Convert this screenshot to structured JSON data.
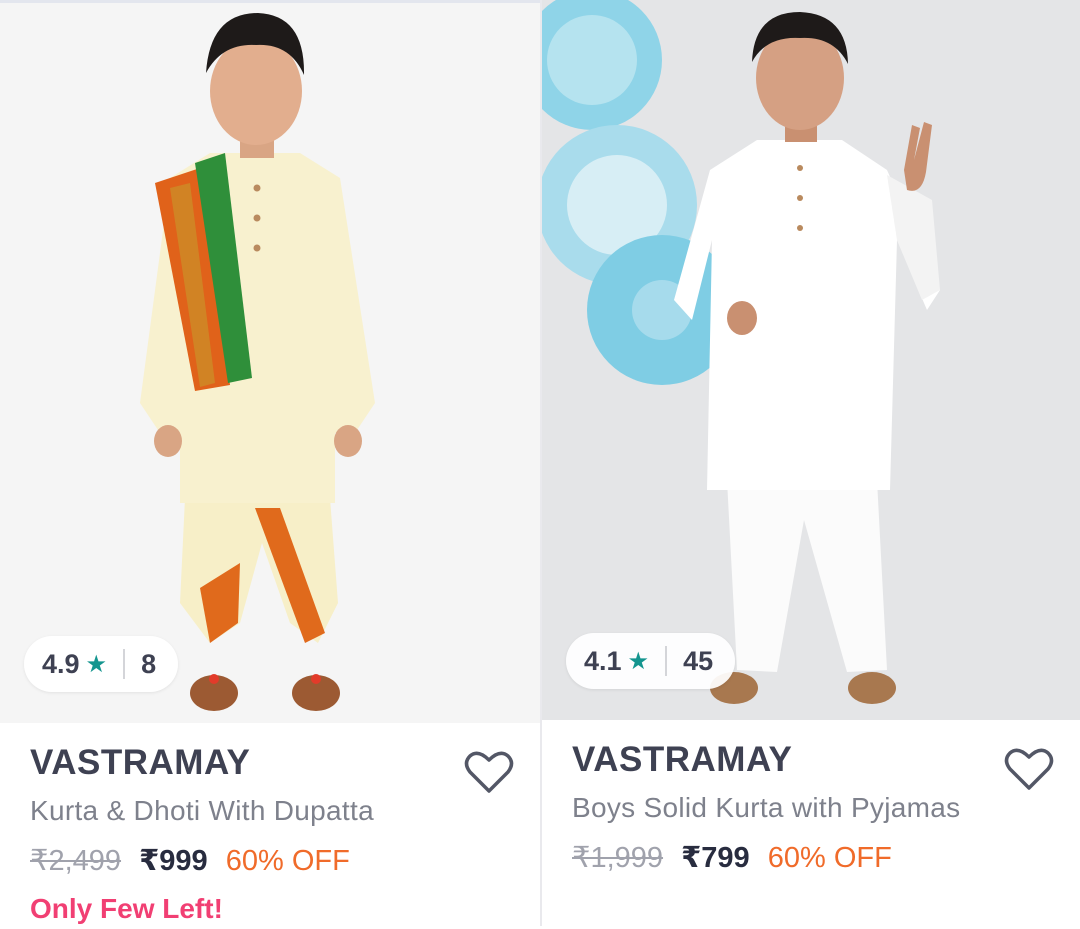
{
  "products": [
    {
      "brand": "VASTRAMAY",
      "title": "Kurta & Dhoti With Dupatta",
      "mrp": "₹2,499",
      "price": "₹999",
      "discount": "60% OFF",
      "rating": "4.9",
      "rating_count": "8",
      "stock_note": "Only Few Left!",
      "icons": [
        "star-icon",
        "heart-icon"
      ]
    },
    {
      "brand": "VASTRAMAY",
      "title": "Boys Solid Kurta with Pyjamas",
      "mrp": "₹1,999",
      "price": "₹799",
      "discount": "60% OFF",
      "rating": "4.1",
      "rating_count": "45",
      "icons": [
        "star-icon",
        "heart-icon"
      ]
    }
  ],
  "colors": {
    "rating_star": "#14958f",
    "discount": "#f06b2a",
    "stock_note": "#f13f73",
    "brand_text": "#3e4152",
    "title_text": "#7e818c"
  }
}
